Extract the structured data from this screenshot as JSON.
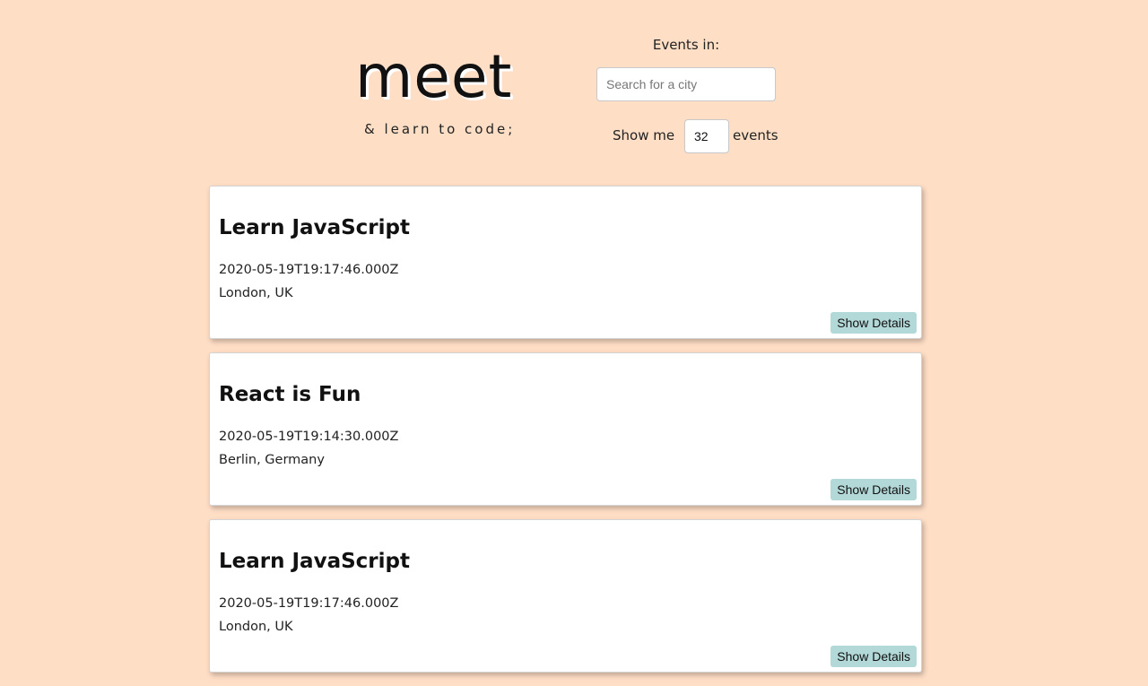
{
  "header": {
    "logo": "meet",
    "tagline": "& learn to code;"
  },
  "city_search": {
    "label": "Events in:",
    "placeholder": "Search for a city",
    "value": ""
  },
  "number_of_events": {
    "prefix": "Show me",
    "value": "32",
    "suffix": "events"
  },
  "events": [
    {
      "title": "Learn JavaScript",
      "date": "2020-05-19T19:17:46.000Z",
      "location": "London, UK",
      "details_label": "Show Details"
    },
    {
      "title": "React is Fun",
      "date": "2020-05-19T19:14:30.000Z",
      "location": "Berlin, Germany",
      "details_label": "Show Details"
    },
    {
      "title": "Learn JavaScript",
      "date": "2020-05-19T19:17:46.000Z",
      "location": "London, UK",
      "details_label": "Show Details"
    }
  ],
  "colors": {
    "background": "#ffdec6",
    "card": "#ffffff",
    "button": "#b3d8d8"
  }
}
